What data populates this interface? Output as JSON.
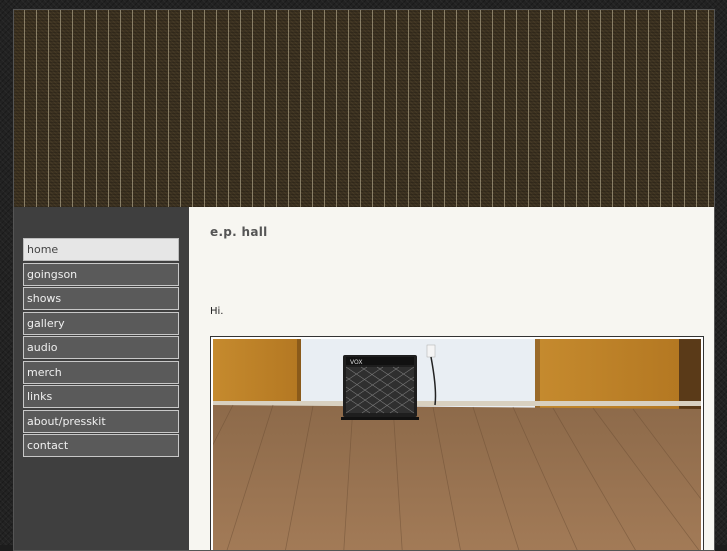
{
  "nav": {
    "items": [
      {
        "label": "home",
        "active": true
      },
      {
        "label": "goingson"
      },
      {
        "label": "shows"
      },
      {
        "label": "gallery"
      },
      {
        "label": "audio"
      },
      {
        "label": "merch"
      },
      {
        "label": "links"
      },
      {
        "label": "about/presskit"
      },
      {
        "label": "contact"
      }
    ]
  },
  "main": {
    "title": "e.p. hall",
    "greeting": "Hi.",
    "photo": {
      "amp_brand": "VOX"
    }
  }
}
